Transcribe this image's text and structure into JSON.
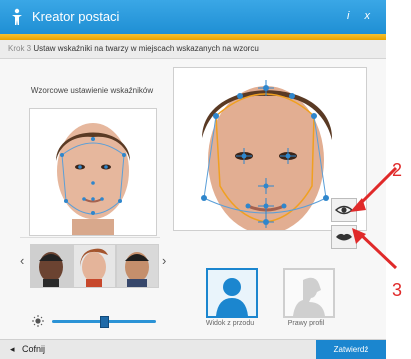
{
  "window": {
    "title": "Kreator postaci",
    "controls": "i  x"
  },
  "stepbar": {
    "step": "Krok 3",
    "instruction": "Ustaw wskaźniki na twarzy w miejscach wskazanych na wzorcu"
  },
  "reference": {
    "title": "Wzorcowe ustawienie wskaźników"
  },
  "views": [
    {
      "label": "Widok z przodu",
      "active": true
    },
    {
      "label": "Prawy profil",
      "active": false
    }
  ],
  "footer": {
    "back_label": "Cofnij",
    "confirm_label": "Zatwierdź"
  },
  "callouts": [
    {
      "number": "2"
    },
    {
      "number": "3"
    }
  ],
  "icons": {
    "title": "figure-icon",
    "brightness": "sun-icon",
    "eye_tool": "eye-icon",
    "lips_tool": "lips-icon"
  },
  "colors": {
    "accent": "#1b86cf",
    "stripe": "#f0b41a",
    "callout": "#e02a2a"
  }
}
